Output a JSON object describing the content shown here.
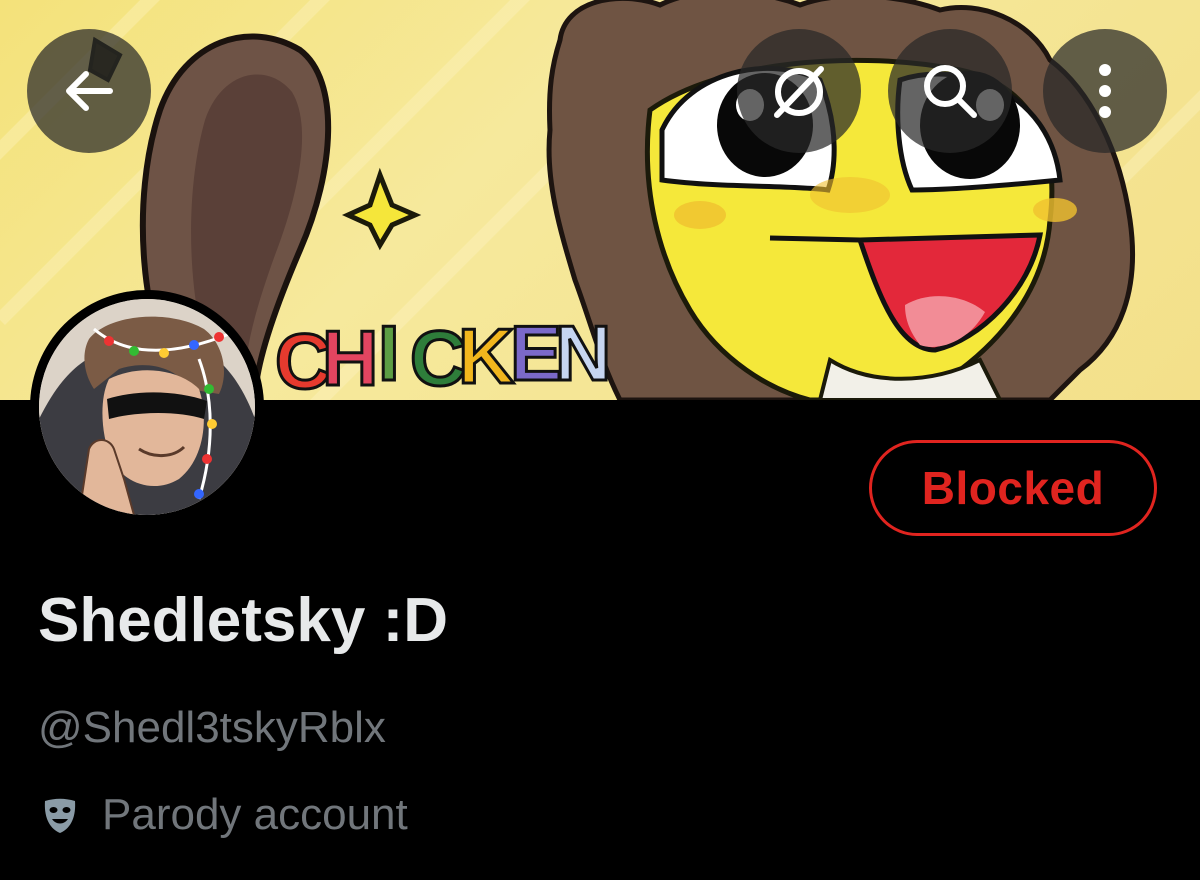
{
  "header": {
    "back_icon": "arrow-left-icon",
    "grok_icon": "grok-icon",
    "search_icon": "search-icon",
    "more_icon": "more-vertical-icon"
  },
  "banner": {
    "artwork_text": "CHICKEN"
  },
  "profile": {
    "display_name": "Shedletsky :D",
    "handle": "@Shedl3tskyRblx",
    "label_icon": "theater-mask-icon",
    "label_text": "Parody account"
  },
  "actions": {
    "blocked_label": "Blocked"
  },
  "colors": {
    "background": "#000000",
    "primary_text": "#e7e9ea",
    "secondary_text": "#71767b",
    "blocked_red": "#e0241f",
    "banner_yellow": "#f4e27a"
  }
}
